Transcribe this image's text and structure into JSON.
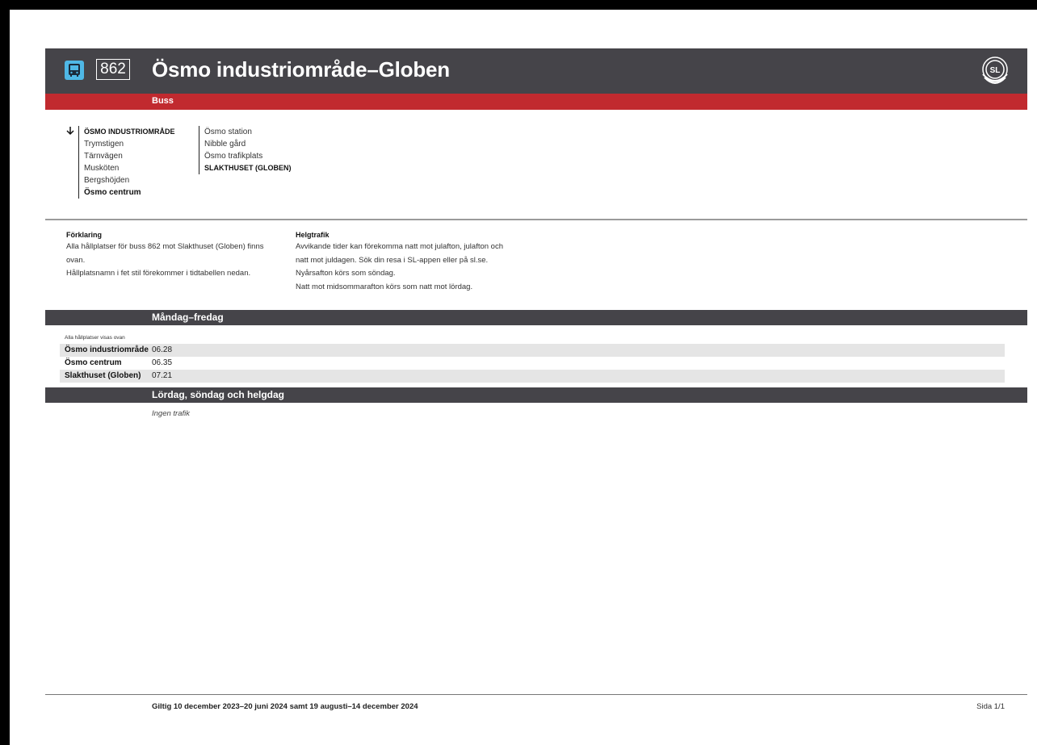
{
  "header": {
    "route_number": "862",
    "title": "Ösmo industriområde–Globen",
    "mode": "Buss",
    "logo_text": "SL"
  },
  "stops": {
    "column1": [
      "ÖSMO INDUSTRIOMRÅDE",
      "Trymstigen",
      "Tärnvägen",
      "Musköten",
      "Bergshöjden",
      "Ösmo centrum"
    ],
    "column2": [
      "Ösmo station",
      "Nibble gård",
      "Ösmo trafikplats",
      "SLAKTHUSET (GLOBEN)"
    ]
  },
  "explanation": {
    "title": "Förklaring",
    "lines": [
      "Alla hållplatser för buss 862 mot Slakthuset (Globen) finns",
      "ovan.",
      "Hållplatsnamn i fet stil förekommer i tidtabellen nedan."
    ]
  },
  "holiday": {
    "title": "Helgtrafik",
    "lines": [
      "Avvikande tider kan förekomma natt mot julafton, julafton och",
      "natt mot juldagen. Sök din resa i SL-appen eller på sl.se.",
      "Nyårsafton körs som söndag.",
      "Natt mot midsommarafton körs som natt mot lördag."
    ]
  },
  "weekday": {
    "heading": "Måndag–fredag",
    "note": "Alla hållplatser visas ovan",
    "rows": [
      {
        "stop": "Ösmo industriområde",
        "time": "06.28"
      },
      {
        "stop": "Ösmo centrum",
        "time": "06.35"
      },
      {
        "stop": "Slakthuset (Globen)",
        "time": "07.21"
      }
    ]
  },
  "weekend": {
    "heading": "Lördag, söndag och helgdag",
    "note": "Ingen trafik"
  },
  "footer": {
    "validity": "Giltig 10 december 2023–20 juni 2024 samt 19 augusti–14 december 2024",
    "page": "Sida 1/1"
  }
}
